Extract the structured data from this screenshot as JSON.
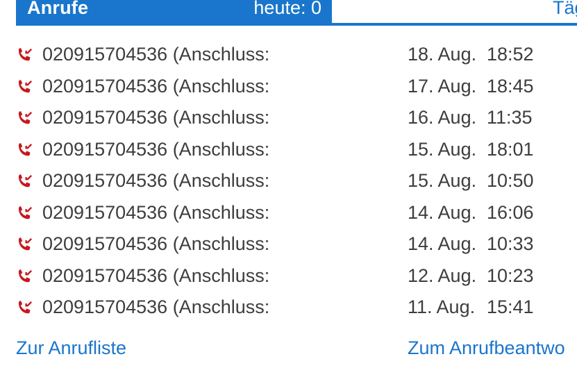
{
  "header": {
    "title": "Anrufe",
    "today": "heute: 0",
    "next_title": "Täg"
  },
  "colors": {
    "accent": "#1976cc",
    "missed_call_icon": "#c8171e",
    "text": "#3d3d3d"
  },
  "calls": [
    {
      "icon": "missed-call-icon",
      "number": "020915704536 (Anschluss:",
      "date": "18. Aug.",
      "time": "18:52"
    },
    {
      "icon": "missed-call-icon",
      "number": "020915704536 (Anschluss:",
      "date": "17. Aug.",
      "time": "18:45"
    },
    {
      "icon": "missed-call-icon",
      "number": "020915704536 (Anschluss:",
      "date": "16. Aug.",
      "time": "11:35"
    },
    {
      "icon": "missed-call-icon",
      "number": "020915704536 (Anschluss:",
      "date": "15. Aug.",
      "time": "18:01"
    },
    {
      "icon": "missed-call-icon",
      "number": "020915704536 (Anschluss:",
      "date": "15. Aug.",
      "time": "10:50"
    },
    {
      "icon": "missed-call-icon",
      "number": "020915704536 (Anschluss:",
      "date": "14. Aug.",
      "time": "16:06"
    },
    {
      "icon": "missed-call-icon",
      "number": "020915704536 (Anschluss:",
      "date": "14. Aug.",
      "time": "10:33"
    },
    {
      "icon": "missed-call-icon",
      "number": "020915704536 (Anschluss:",
      "date": "12. Aug.",
      "time": "10:23"
    },
    {
      "icon": "missed-call-icon",
      "number": "020915704536 (Anschluss:",
      "date": "11. Aug.",
      "time": "15:41"
    }
  ],
  "links": {
    "call_list": "Zur Anrufliste",
    "answering_machine": "Zum Anrufbeantwo"
  }
}
